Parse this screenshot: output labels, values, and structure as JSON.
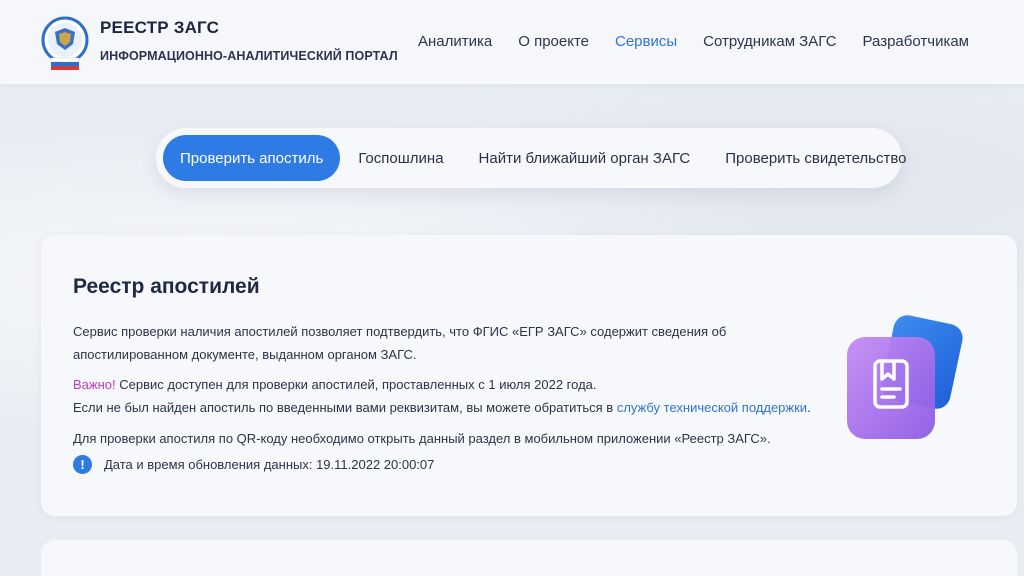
{
  "header": {
    "title": "РЕЕСТР ЗАГС",
    "subtitle": "ИНФОРМАЦИОННО-АНАЛИТИЧЕСКИЙ ПОРТАЛ",
    "nav": [
      {
        "label": "Аналитика",
        "active": false
      },
      {
        "label": "О проекте",
        "active": false
      },
      {
        "label": "Сервисы",
        "active": true
      },
      {
        "label": "Сотрудникам ЗАГС",
        "active": false
      },
      {
        "label": "Разработчикам",
        "active": false
      }
    ]
  },
  "tabs": [
    {
      "label": "Проверить апостиль",
      "active": true
    },
    {
      "label": "Госпошлина",
      "active": false
    },
    {
      "label": "Найти ближайший орган ЗАГС",
      "active": false
    },
    {
      "label": "Проверить свидетельство",
      "active": false
    }
  ],
  "card": {
    "title": "Реестр апостилей",
    "p1": "Сервис проверки наличия апостилей позволяет подтвердить, что ФГИС «ЕГР ЗАГС» содержит сведения об апостилированном документе, выданном органом ЗАГС.",
    "p2_important": "Важно!",
    "p2_rest": " Сервис доступен для проверки апостилей, проставленных с 1 июля 2022 года.",
    "p2_line2_prefix": "Если не был найден апостиль по введенными вами реквизитам, вы можете обратиться в ",
    "p2_link": "службу технической поддержки",
    "p2_line2_suffix": ".",
    "p3": "Для проверки апостиля по QR-коду необходимо открыть данный раздел в мобильном приложении «Реестр ЗАГС».",
    "update_text": "Дата и время обновления данных: 19.11.2022 20:00:07",
    "info_icon": "info-icon",
    "illustration_icon": "document-bookmark-icon"
  },
  "colors": {
    "accent": "#2f7be6",
    "link": "#3173d6",
    "important": "#c03ac8",
    "text": "#222a3d"
  }
}
